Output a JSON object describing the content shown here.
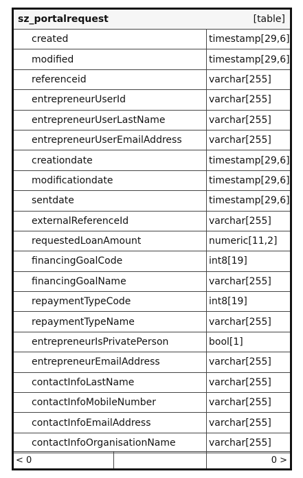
{
  "table": {
    "name": "sz_portalrequest",
    "kind": "[table]",
    "columns": [
      {
        "name": "created",
        "type": "timestamp[29,6]"
      },
      {
        "name": "modified",
        "type": "timestamp[29,6]"
      },
      {
        "name": "referenceid",
        "type": "varchar[255]"
      },
      {
        "name": "entrepreneurUserId",
        "type": "varchar[255]"
      },
      {
        "name": "entrepreneurUserLastName",
        "type": "varchar[255]"
      },
      {
        "name": "entrepreneurUserEmailAddress",
        "type": "varchar[255]"
      },
      {
        "name": "creationdate",
        "type": "timestamp[29,6]"
      },
      {
        "name": "modificationdate",
        "type": "timestamp[29,6]"
      },
      {
        "name": "sentdate",
        "type": "timestamp[29,6]"
      },
      {
        "name": "externalReferenceId",
        "type": "varchar[255]"
      },
      {
        "name": "requestedLoanAmount",
        "type": "numeric[11,2]"
      },
      {
        "name": "financingGoalCode",
        "type": "int8[19]"
      },
      {
        "name": "financingGoalName",
        "type": "varchar[255]"
      },
      {
        "name": "repaymentTypeCode",
        "type": "int8[19]"
      },
      {
        "name": "repaymentTypeName",
        "type": "varchar[255]"
      },
      {
        "name": "entrepreneurIsPrivatePerson",
        "type": "bool[1]"
      },
      {
        "name": "entrepreneurEmailAddress",
        "type": "varchar[255]"
      },
      {
        "name": "contactInfoLastName",
        "type": "varchar[255]"
      },
      {
        "name": "contactInfoMobileNumber",
        "type": "varchar[255]"
      },
      {
        "name": "contactInfoEmailAddress",
        "type": "varchar[255]"
      },
      {
        "name": "contactInfoOrganisationName",
        "type": "varchar[255]"
      }
    ]
  },
  "footer": {
    "left": "< 0",
    "right": "0 >"
  }
}
